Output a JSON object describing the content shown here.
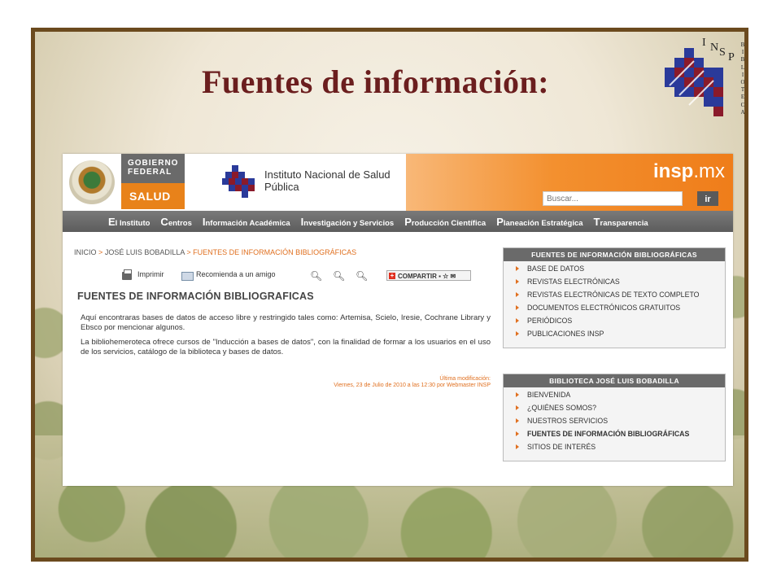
{
  "slide": {
    "title": "Fuentes de información:",
    "logo": {
      "letters": [
        "I",
        "N",
        "S",
        "P"
      ],
      "vertical_text": [
        "B",
        "I",
        "B",
        "L",
        "I",
        "O",
        "T",
        "E",
        "C",
        "A"
      ]
    }
  },
  "website": {
    "gobierno_label": "GOBIERNO FEDERAL",
    "salud_label": "SALUD",
    "institute_name": "Instituto Nacional de Salud Pública",
    "brand": {
      "bold": "insp",
      "rest": ".mx"
    },
    "search": {
      "placeholder": "Buscar...",
      "button": "ir"
    },
    "nav": [
      {
        "initial": "E",
        "rest": "l Instituto"
      },
      {
        "initial": "C",
        "rest": "entros"
      },
      {
        "initial": "I",
        "rest": "nformación Académica"
      },
      {
        "initial": "I",
        "rest": "nvestigación y Servicios"
      },
      {
        "initial": "P",
        "rest": "roducción Científica"
      },
      {
        "initial": "P",
        "rest": "laneación Estratégica"
      },
      {
        "initial": "T",
        "rest": "ransparencia"
      }
    ],
    "breadcrumb": {
      "items": [
        "INICIO",
        "JOSÉ LUIS BOBADILLA"
      ],
      "current": "FUENTES DE INFORMACIÓN BIBLIOGRÁFICAS",
      "separator": ">"
    },
    "tools": {
      "print": "Imprimir",
      "recommend": "Recomienda a un amigo",
      "share": "COMPARTIR"
    },
    "page_heading": "FUENTES DE INFORMACIÓN BIBLIOGRAFICAS",
    "paragraphs": [
      "Aquí encontraras bases de datos de acceso libre y restringido tales como: Artemisa, Scielo, Iresie, Cochrane Library y Ebsco por mencionar algunos.",
      "La bibliohemeroteca ofrece cursos de \"Inducción a bases de datos\", con la finalidad de formar a los usuarios en el uso de los servicios, catálogo de la biblioteca y bases de datos."
    ],
    "last_modified": {
      "label": "Última modificación:",
      "value": "Viernes, 23 de Julio de 2010 a las 12:30 por Webmaster INSP"
    },
    "sidebar_boxes": [
      {
        "title": "FUENTES DE INFORMACIÓN BIBLIOGRÁFICAS",
        "items": [
          "BASE DE DATOS",
          "REVISTAS ELECTRÓNICAS",
          "REVISTAS ELECTRÓNICAS DE TEXTO COMPLETO",
          "DOCUMENTOS ELECTRÓNICOS GRATUITOS",
          "PERIÓDICOS",
          "PUBLICACIONES INSP"
        ]
      },
      {
        "title": "BIBLIOTECA JOSÉ LUIS BOBADILLA",
        "items": [
          "BIENVENIDA",
          "¿QUIÉNES SOMOS?",
          "NUESTROS SERVICIOS",
          "FUENTES DE INFORMACIÓN BIBLIOGRÁFICAS",
          "SITIOS DE INTERÉS"
        ],
        "active_index": 3
      }
    ]
  },
  "colors": {
    "frame": "#6b4a1e",
    "title": "#6b1e1e",
    "accent": "#e07020",
    "logo_blue": "#2a3a9a",
    "logo_red": "#8a1a2a"
  }
}
